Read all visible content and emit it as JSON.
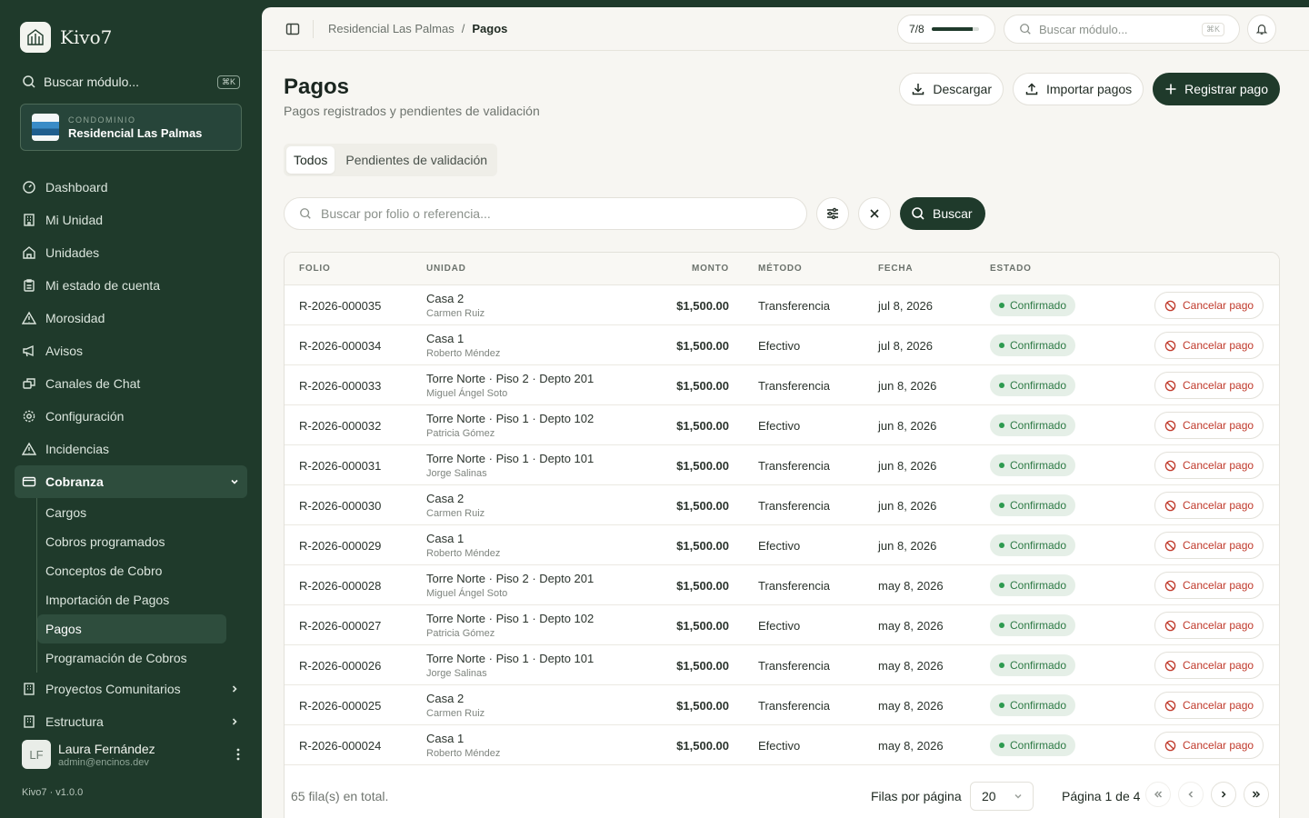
{
  "brand": {
    "name": "Kivo7"
  },
  "sidebar": {
    "search_label": "Buscar módulo...",
    "search_kbd": "⌘K",
    "condo_kicker": "CONDOMINIO",
    "condo_name": "Residencial Las Palmas",
    "items": [
      {
        "label": "Dashboard",
        "icon": "gauge-icon"
      },
      {
        "label": "Mi Unidad",
        "icon": "building-icon"
      },
      {
        "label": "Unidades",
        "icon": "home-icon"
      },
      {
        "label": "Mi estado de cuenta",
        "icon": "clipboard-icon"
      },
      {
        "label": "Morosidad",
        "icon": "warning-icon"
      },
      {
        "label": "Avisos",
        "icon": "megaphone-icon"
      },
      {
        "label": "Canales de Chat",
        "icon": "chat-icon"
      },
      {
        "label": "Configuración",
        "icon": "gear-icon"
      },
      {
        "label": "Incidencias",
        "icon": "warning-icon"
      }
    ],
    "cobranza": {
      "label": "Cobranza",
      "sub": [
        "Cargos",
        "Cobros programados",
        "Conceptos de Cobro",
        "Importación de Pagos",
        "Pagos",
        "Programación de Cobros"
      ]
    },
    "bottom_items": [
      {
        "label": "Proyectos Comunitarios"
      },
      {
        "label": "Estructura"
      }
    ],
    "user": {
      "initials": "LF",
      "name": "Laura Fernández",
      "email": "admin@encinos.dev"
    },
    "version": "Kivo7 · v1.0.0"
  },
  "topbar": {
    "crumbs": [
      "Residencial Las Palmas",
      "Pagos"
    ],
    "crumb_sep": "/",
    "progress_label": "7/8",
    "progress_fraction": 0.875,
    "search_placeholder": "Buscar módulo...",
    "search_kbd": "⌘K"
  },
  "page": {
    "title": "Pagos",
    "subtitle": "Pagos registrados y pendientes de validación",
    "btn_download": "Descargar",
    "btn_import": "Importar pagos",
    "btn_register": "Registrar pago",
    "tabs": [
      "Todos",
      "Pendientes de validación"
    ],
    "filter_placeholder": "Buscar por folio o referencia...",
    "search_button": "Buscar"
  },
  "table": {
    "headers": {
      "folio": "FOLIO",
      "unidad": "UNIDAD",
      "monto": "MONTO",
      "metodo": "MÉTODO",
      "fecha": "FECHA",
      "estado": "ESTADO"
    },
    "cancel_label": "Cancelar pago",
    "rows": [
      {
        "folio": "R-2026-000035",
        "unit": "Casa 2",
        "owner": "Carmen Ruiz",
        "amount": "$1,500.00",
        "method": "Transferencia",
        "date": "jul 8, 2026",
        "status": "Confirmado"
      },
      {
        "folio": "R-2026-000034",
        "unit": "Casa 1",
        "owner": "Roberto Méndez",
        "amount": "$1,500.00",
        "method": "Efectivo",
        "date": "jul 8, 2026",
        "status": "Confirmado"
      },
      {
        "folio": "R-2026-000033",
        "unit": "Torre Norte · Piso 2 · Depto 201",
        "owner": "Miguel Ángel Soto",
        "amount": "$1,500.00",
        "method": "Transferencia",
        "date": "jun 8, 2026",
        "status": "Confirmado"
      },
      {
        "folio": "R-2026-000032",
        "unit": "Torre Norte · Piso 1 · Depto 102",
        "owner": "Patricia Gómez",
        "amount": "$1,500.00",
        "method": "Efectivo",
        "date": "jun 8, 2026",
        "status": "Confirmado"
      },
      {
        "folio": "R-2026-000031",
        "unit": "Torre Norte · Piso 1 · Depto 101",
        "owner": "Jorge Salinas",
        "amount": "$1,500.00",
        "method": "Transferencia",
        "date": "jun 8, 2026",
        "status": "Confirmado"
      },
      {
        "folio": "R-2026-000030",
        "unit": "Casa 2",
        "owner": "Carmen Ruiz",
        "amount": "$1,500.00",
        "method": "Transferencia",
        "date": "jun 8, 2026",
        "status": "Confirmado"
      },
      {
        "folio": "R-2026-000029",
        "unit": "Casa 1",
        "owner": "Roberto Méndez",
        "amount": "$1,500.00",
        "method": "Efectivo",
        "date": "jun 8, 2026",
        "status": "Confirmado"
      },
      {
        "folio": "R-2026-000028",
        "unit": "Torre Norte · Piso 2 · Depto 201",
        "owner": "Miguel Ángel Soto",
        "amount": "$1,500.00",
        "method": "Transferencia",
        "date": "may 8, 2026",
        "status": "Confirmado"
      },
      {
        "folio": "R-2026-000027",
        "unit": "Torre Norte · Piso 1 · Depto 102",
        "owner": "Patricia Gómez",
        "amount": "$1,500.00",
        "method": "Efectivo",
        "date": "may 8, 2026",
        "status": "Confirmado"
      },
      {
        "folio": "R-2026-000026",
        "unit": "Torre Norte · Piso 1 · Depto 101",
        "owner": "Jorge Salinas",
        "amount": "$1,500.00",
        "method": "Transferencia",
        "date": "may 8, 2026",
        "status": "Confirmado"
      },
      {
        "folio": "R-2026-000025",
        "unit": "Casa 2",
        "owner": "Carmen Ruiz",
        "amount": "$1,500.00",
        "method": "Transferencia",
        "date": "may 8, 2026",
        "status": "Confirmado"
      },
      {
        "folio": "R-2026-000024",
        "unit": "Casa 1",
        "owner": "Roberto Méndez",
        "amount": "$1,500.00",
        "method": "Efectivo",
        "date": "may 8, 2026",
        "status": "Confirmado"
      }
    ]
  },
  "footer": {
    "rows_total": "65 fila(s) en total.",
    "per_page_label": "Filas por página",
    "per_page_value": "20",
    "page_info": "Página 1 de 4"
  },
  "colors": {
    "brand": "#1f3a2b",
    "confirm": "#2d7a45",
    "danger": "#c0392b"
  }
}
